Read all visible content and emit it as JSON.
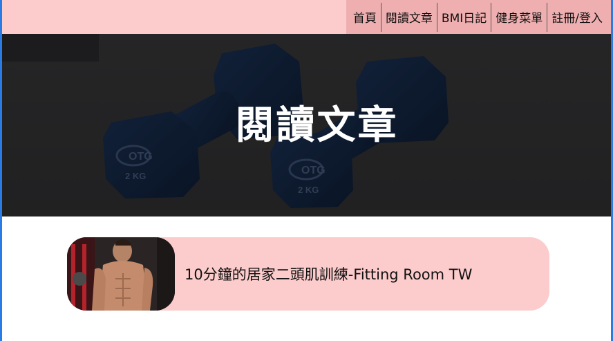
{
  "nav": {
    "items": [
      {
        "label": "首頁"
      },
      {
        "label": "閱讀文章"
      },
      {
        "label": "BMI日記"
      },
      {
        "label": "健身菜單"
      },
      {
        "label": "註冊/登入"
      }
    ]
  },
  "hero": {
    "title": "閱讀文章",
    "dumbbell_brand": "OTG",
    "dumbbell_weight": "2 KG"
  },
  "articles": [
    {
      "title": "10分鐘的居家二頭肌訓練-Fitting Room TW",
      "thumbnail_icon": "fitness-man-photo"
    }
  ],
  "colors": {
    "header_bg": "#fccbcb",
    "nav_bg": "#efafb0",
    "card_bg": "#fccbcb",
    "hero_overlay": "#3b3b3d",
    "dumbbell": "#16294a"
  }
}
